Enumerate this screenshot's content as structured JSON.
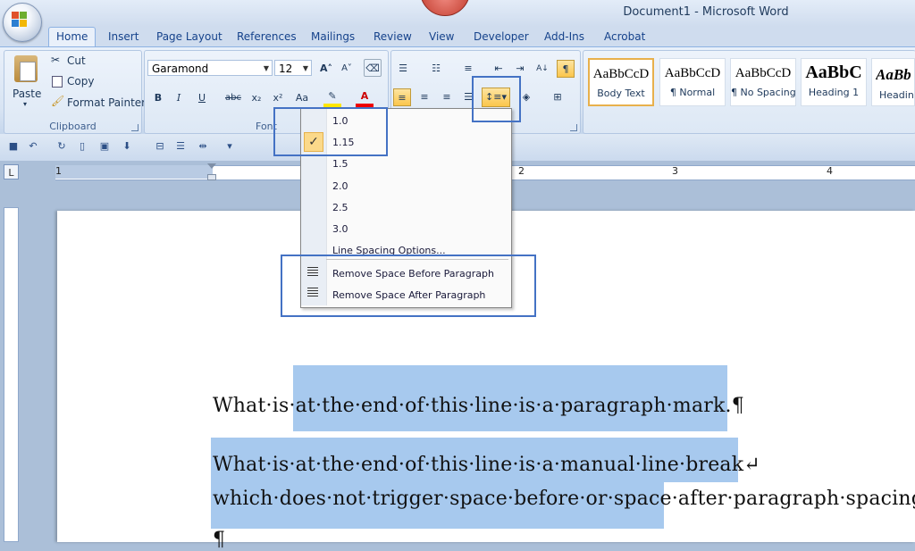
{
  "window": {
    "title": "Document1 - Microsoft Word"
  },
  "tabs": [
    "Home",
    "Insert",
    "Page Layout",
    "References",
    "Mailings",
    "Review",
    "View",
    "Developer",
    "Add-Ins",
    "Acrobat"
  ],
  "clipboard": {
    "paste": "Paste",
    "cut": "Cut",
    "copy": "Copy",
    "format_painter": "Format Painter",
    "label": "Clipboard"
  },
  "font": {
    "name": "Garamond",
    "size": "12",
    "label": "Font",
    "bold": "B",
    "italic": "I",
    "underline": "U",
    "strike": "abc",
    "sub": "x₂",
    "sup": "x²",
    "case": "Aa"
  },
  "styles": [
    {
      "sample": "AaBbCcD",
      "name": "Body Text"
    },
    {
      "sample": "AaBbCcD",
      "name": "¶ Normal"
    },
    {
      "sample": "AaBbCcD",
      "name": "¶ No Spacing"
    },
    {
      "sample": "AaBbC",
      "name": "Heading 1"
    },
    {
      "sample": "AaBb",
      "name": "Heading"
    }
  ],
  "line_spacing_menu": {
    "items": [
      "1.0",
      "1.15",
      "1.5",
      "2.0",
      "2.5",
      "3.0"
    ],
    "checked": "1.15",
    "options": "Line Spacing Options...",
    "remove_before": "Remove Space Before Paragraph",
    "remove_after": "Remove Space After Paragraph"
  },
  "ruler": {
    "numbers": [
      "1",
      "1",
      "2",
      "3",
      "4"
    ]
  },
  "document": {
    "line1_pre": "What·is·",
    "line1_sel": "at·the·end·of·this·line·is·a·paragraph·mark.¶",
    "line2": "What·is·at·the·end·of·this·line·is·a·manual·line·break↵",
    "line3_sel": "which·does·not·trigger·space·before·or·space·",
    "line3_post": "after·paragraph·spacing.¶",
    "line4": "¶"
  },
  "colors": {
    "highlight": "#a7c9ee",
    "annotation": "#4472c4",
    "selected_button": "#fbc64c"
  }
}
